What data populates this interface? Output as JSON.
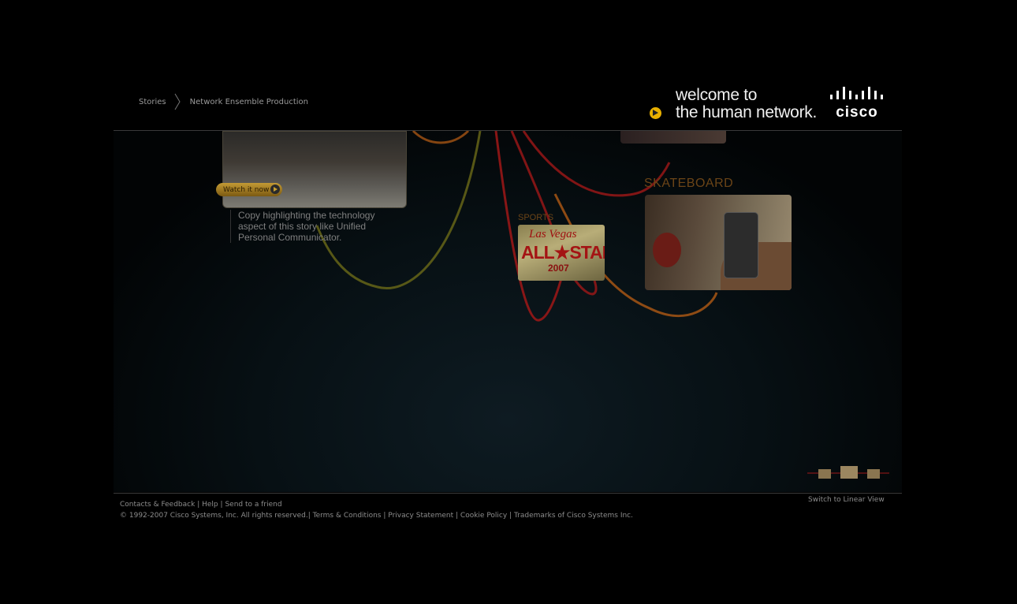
{
  "breadcrumb": {
    "home": "Stories",
    "current": "Network Ensemble Production"
  },
  "brand": {
    "tagline_line1": "welcome to",
    "tagline_line2": "the human network.",
    "logo_text": "cisco"
  },
  "story": {
    "watch_label": "Watch it now",
    "copy": "Copy highlighting the technology aspect of this story like Unified Personal Communicator."
  },
  "sports": {
    "label": "SPORTS",
    "thumb_line1": "Las Vegas",
    "thumb_line2": "ALL★STAR",
    "thumb_line3": "2007"
  },
  "skateboard": {
    "label": "SKATEBOARD"
  },
  "footer": {
    "links_row1": [
      "Contacts & Feedback",
      "Help",
      "Send to a friend"
    ],
    "copyright": "© 1992-2007 Cisco Systems, Inc. All rights reserved.",
    "links_row2": [
      "Terms & Conditions",
      "Privacy Statement",
      "Cookie Policy",
      "Trademarks of Cisco Systems Inc."
    ],
    "separator": "|",
    "switch_view": "Switch to Linear View"
  },
  "colors": {
    "accent": "#e8b000",
    "curve_red": "#a01818",
    "curve_orange": "#b05a14",
    "curve_olive": "#6b6a18",
    "label_brown": "#6b4417"
  }
}
